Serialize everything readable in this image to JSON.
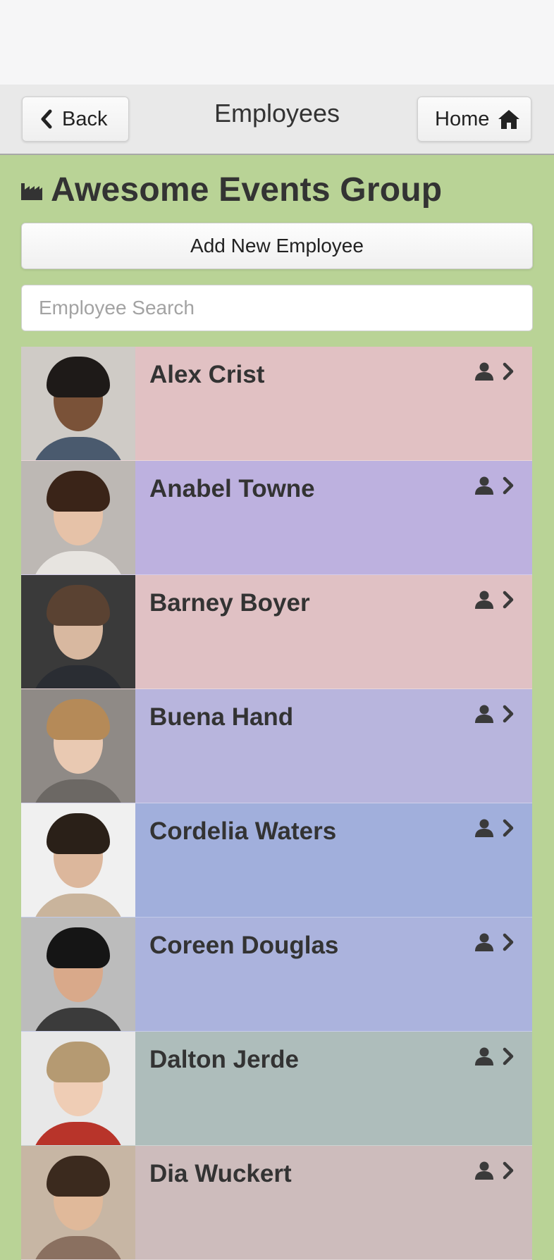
{
  "header": {
    "title": "Employees",
    "back_label": "Back",
    "home_label": "Home"
  },
  "company": {
    "name": "Awesome Events Group",
    "icon": "factory-icon"
  },
  "actions": {
    "add_label": "Add New Employee"
  },
  "search": {
    "placeholder": "Employee Search",
    "value": ""
  },
  "employees": [
    {
      "name": "Alex Crist",
      "row_color": "#e1c1c3",
      "photo": {
        "bg": "#cfcbc6",
        "hair": "#1e1a18",
        "skin": "#7a5238",
        "cloth": "#4a5a6e"
      }
    },
    {
      "name": "Anabel Towne",
      "row_color": "#bdb1df",
      "photo": {
        "bg": "#bdb8b4",
        "hair": "#3a2418",
        "skin": "#e6c2a8",
        "cloth": "#e7e4e0"
      }
    },
    {
      "name": "Barney Boyer",
      "row_color": "#e0c1c4",
      "photo": {
        "bg": "#3a3a3a",
        "hair": "#5a4232",
        "skin": "#d8b8a0",
        "cloth": "#2a2d33"
      }
    },
    {
      "name": "Buena Hand",
      "row_color": "#b8b5dd",
      "photo": {
        "bg": "#8f8a86",
        "hair": "#b58a58",
        "skin": "#e9c9b2",
        "cloth": "#6c6864"
      }
    },
    {
      "name": "Cordelia Waters",
      "row_color": "#a1afdc",
      "photo": {
        "bg": "#f0f0f0",
        "hair": "#2a2018",
        "skin": "#dcb79c",
        "cloth": "#c9b49c"
      }
    },
    {
      "name": "Coreen Douglas",
      "row_color": "#abb3dd",
      "photo": {
        "bg": "#bcbcbc",
        "hair": "#151515",
        "skin": "#d9a98a",
        "cloth": "#3b3b3b"
      }
    },
    {
      "name": "Dalton Jerde",
      "row_color": "#aebdbb",
      "photo": {
        "bg": "#e8e8e8",
        "hair": "#b59a72",
        "skin": "#efcdb5",
        "cloth": "#b8342a"
      }
    },
    {
      "name": "Dia Wuckert",
      "row_color": "#cdbcbc",
      "photo": {
        "bg": "#c7b6a4",
        "hair": "#3b2a1e",
        "skin": "#e0b99a",
        "cloth": "#8a7060"
      }
    }
  ]
}
